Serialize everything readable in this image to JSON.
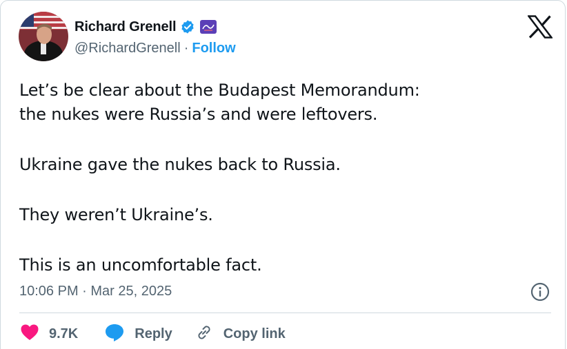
{
  "author": {
    "display_name": "Richard Grenell",
    "handle": "@RichardGrenell",
    "separator": "·",
    "follow_label": "Follow"
  },
  "tweet": {
    "paragraphs": [
      "Let’s be clear about the Budapest Memorandum:",
      "the nukes were Russia’s and were leftovers.",
      "Ukraine gave the nukes back to Russia.",
      "They weren’t Ukraine’s.",
      "This is an uncomfortable fact."
    ],
    "timestamp": "10:06 PM · Mar 25, 2025"
  },
  "actions": {
    "likes_count": "9.7K",
    "reply_label": "Reply",
    "copy_link_label": "Copy link"
  },
  "icons": {
    "verified": "verified-badge-icon",
    "affiliate": "affiliate-badge-icon",
    "x_logo": "x-logo-icon",
    "info": "info-icon",
    "like": "heart-icon",
    "reply": "reply-bubble-icon",
    "copy_link": "link-icon"
  },
  "colors": {
    "accent": "#1d9bf0",
    "like": "#f91880",
    "text": "#0f1419",
    "muted": "#536471",
    "border": "#cfd9de"
  }
}
